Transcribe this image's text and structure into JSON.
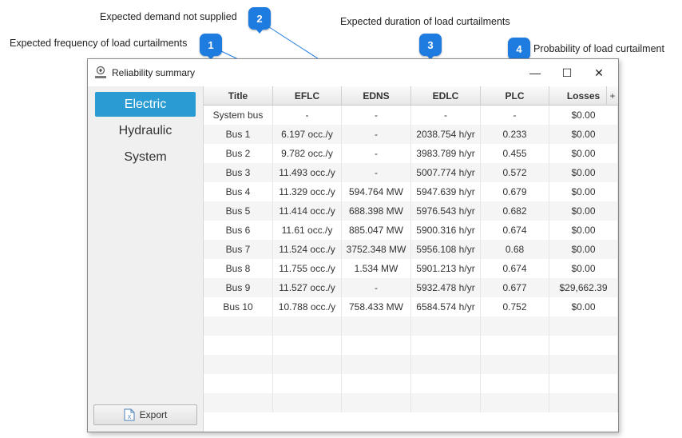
{
  "callouts": [
    {
      "number": "1",
      "text": "Expected frequency of load curtailments"
    },
    {
      "number": "2",
      "text": "Expected demand not supplied"
    },
    {
      "number": "3",
      "text": "Expected duration of load curtailments"
    },
    {
      "number": "4",
      "text": "Probability of load curtailment"
    }
  ],
  "window": {
    "title": "Reliability summary",
    "minimize_glyph": "—",
    "maximize_glyph": "☐",
    "close_glyph": "✕"
  },
  "sidebar": {
    "items": [
      {
        "label": "Electric",
        "active": true
      },
      {
        "label": "Hydraulic",
        "active": false
      },
      {
        "label": "System",
        "active": false
      }
    ],
    "export_label": "Export"
  },
  "table": {
    "columns": [
      "Title",
      "EFLC",
      "EDNS",
      "EDLC",
      "PLC",
      "Losses"
    ],
    "add_column_glyph": "+",
    "rows": [
      [
        "System bus",
        "-",
        "-",
        "-",
        "-",
        "$0.00"
      ],
      [
        "Bus 1",
        "6.197 occ./y",
        "-",
        "2038.754 h/yr",
        "0.233",
        "$0.00"
      ],
      [
        "Bus 2",
        "9.782 occ./y",
        "-",
        "3983.789 h/yr",
        "0.455",
        "$0.00"
      ],
      [
        "Bus 3",
        "11.493 occ./y",
        "-",
        "5007.774 h/yr",
        "0.572",
        "$0.00"
      ],
      [
        "Bus 4",
        "11.329 occ./y",
        "594.764 MW",
        "5947.639 h/yr",
        "0.679",
        "$0.00"
      ],
      [
        "Bus 5",
        "11.414 occ./y",
        "688.398 MW",
        "5976.543 h/yr",
        "0.682",
        "$0.00"
      ],
      [
        "Bus 6",
        "11.61 occ./y",
        "885.047 MW",
        "5900.316 h/yr",
        "0.674",
        "$0.00"
      ],
      [
        "Bus 7",
        "11.524 occ./y",
        "3752.348 MW",
        "5956.108 h/yr",
        "0.68",
        "$0.00"
      ],
      [
        "Bus 8",
        "11.755 occ./y",
        "1.534 MW",
        "5901.213 h/yr",
        "0.674",
        "$0.00"
      ],
      [
        "Bus 9",
        "11.527 occ./y",
        "-",
        "5932.478 h/yr",
        "0.677",
        "$29,662.39"
      ],
      [
        "Bus 10",
        "10.788 occ./y",
        "758.433 MW",
        "6584.574 h/yr",
        "0.752",
        "$0.00"
      ],
      [
        "",
        "",
        "",
        "",
        "",
        ""
      ],
      [
        "",
        "",
        "",
        "",
        "",
        ""
      ],
      [
        "",
        "",
        "",
        "",
        "",
        ""
      ],
      [
        "",
        "",
        "",
        "",
        "",
        ""
      ],
      [
        "",
        "",
        "",
        "",
        "",
        ""
      ]
    ]
  },
  "colors": {
    "accent": "#2a9bd3",
    "badge": "#1e7be0"
  }
}
